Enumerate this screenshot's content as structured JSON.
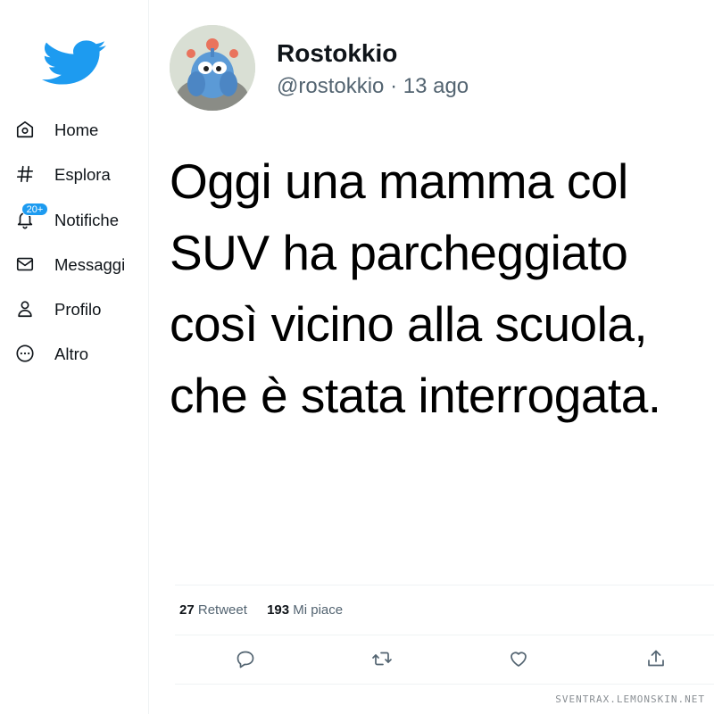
{
  "brand": {
    "logo_icon": "twitter-bird-icon",
    "color": "#1d9bf0"
  },
  "sidebar": {
    "items": [
      {
        "label": "Home",
        "icon": "home-icon"
      },
      {
        "label": "Esplora",
        "icon": "hashtag-icon"
      },
      {
        "label": "Notifiche",
        "icon": "bell-icon",
        "badge": "20+"
      },
      {
        "label": "Messaggi",
        "icon": "envelope-icon"
      },
      {
        "label": "Profilo",
        "icon": "person-icon"
      },
      {
        "label": "Altro",
        "icon": "more-circle-icon"
      }
    ]
  },
  "tweet": {
    "author": {
      "name": "Rostokkio",
      "handle": "@rostokkio",
      "time": "13 ago"
    },
    "text": "Oggi una mamma col SUV ha parcheggiato così vicino alla scuola, che è stata interrogata.",
    "stats": {
      "retweets": "27",
      "retweets_label": "Retweet",
      "likes": "193",
      "likes_label": "Mi piace"
    },
    "actions": [
      {
        "icon": "reply-icon"
      },
      {
        "icon": "retweet-icon"
      },
      {
        "icon": "like-heart-icon"
      },
      {
        "icon": "share-icon"
      }
    ]
  },
  "watermark": "SVENTRAX.LEMONSKIN.NET"
}
